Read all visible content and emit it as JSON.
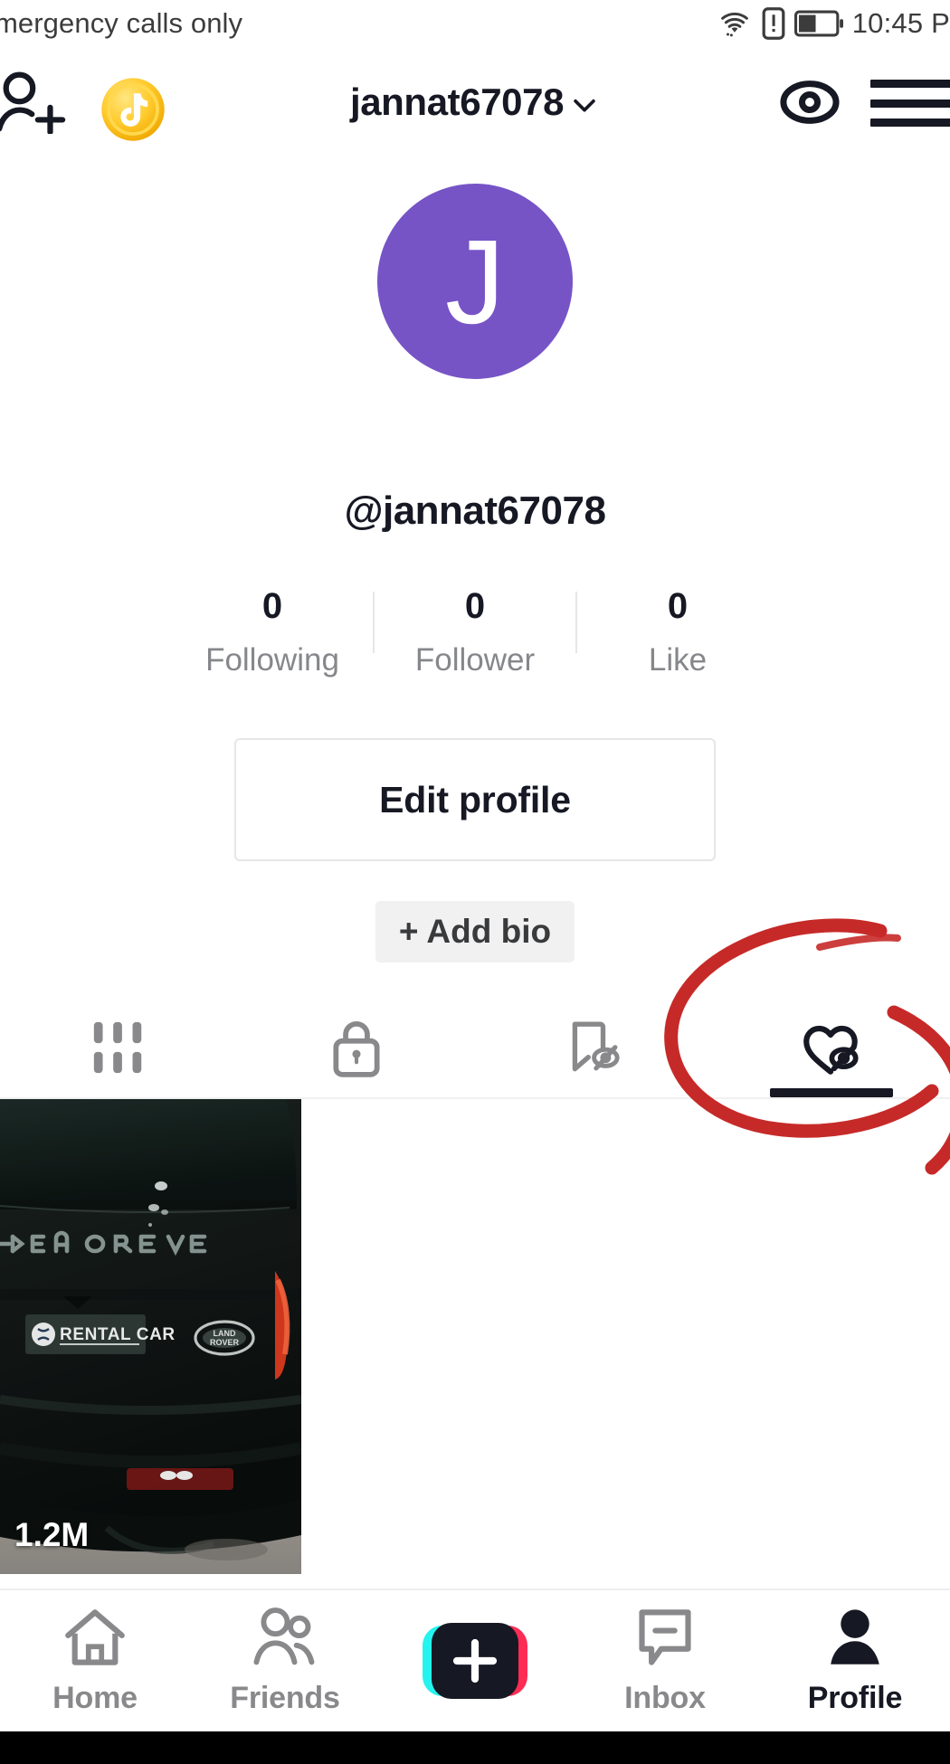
{
  "status_bar": {
    "carrier_text": "mergency calls only",
    "time": "10:45 P",
    "icons": [
      "wifi-icon",
      "sim-alert-icon",
      "battery-icon"
    ]
  },
  "header": {
    "add_person_icon": "add-person-icon",
    "coin_icon": "tiktok-coin-icon",
    "title": "jannat67078",
    "chevron_icon": "chevron-down-icon",
    "eye_icon": "eye-icon",
    "menu_icon": "hamburger-menu-icon"
  },
  "profile": {
    "avatar_letter": "J",
    "avatar_color": "#7654C6",
    "handle": "@jannat67078",
    "stats": [
      {
        "value": "0",
        "label": "Following"
      },
      {
        "value": "0",
        "label": "Follower"
      },
      {
        "value": "0",
        "label": "Like"
      }
    ],
    "edit_profile_label": "Edit profile",
    "add_bio_label": "+ Add bio"
  },
  "tabs": [
    {
      "name": "videos-tab",
      "icon": "grid-icon",
      "active": false
    },
    {
      "name": "private-tab",
      "icon": "lock-icon",
      "active": false
    },
    {
      "name": "saved-tab",
      "icon": "bookmark-hidden-icon",
      "active": false
    },
    {
      "name": "liked-tab",
      "icon": "heart-hidden-icon",
      "active": true
    }
  ],
  "video_grid": {
    "items": [
      {
        "views": "1.2M",
        "thumbnail_description": "dark Range Rover rear",
        "badge_text": "RENTAL CAR",
        "vehicle_text": "NGE ROVER",
        "brand_badge": "LAND ROVER"
      }
    ]
  },
  "annotation": {
    "shape": "hand-drawn-ellipse",
    "color": "#C62A28",
    "targets": "liked-tab"
  },
  "bottom_nav": {
    "items": [
      {
        "label": "Home",
        "icon": "home-icon",
        "active": false
      },
      {
        "label": "Friends",
        "icon": "friends-icon",
        "active": false
      },
      {
        "label": "",
        "icon": "create-plus-icon",
        "active": false
      },
      {
        "label": "Inbox",
        "icon": "inbox-icon",
        "active": false
      },
      {
        "label": "Profile",
        "icon": "profile-person-icon",
        "active": true
      }
    ],
    "create_colors": {
      "cyan": "#25F4EE",
      "pink": "#FE2C55",
      "dark": "#161823"
    }
  }
}
